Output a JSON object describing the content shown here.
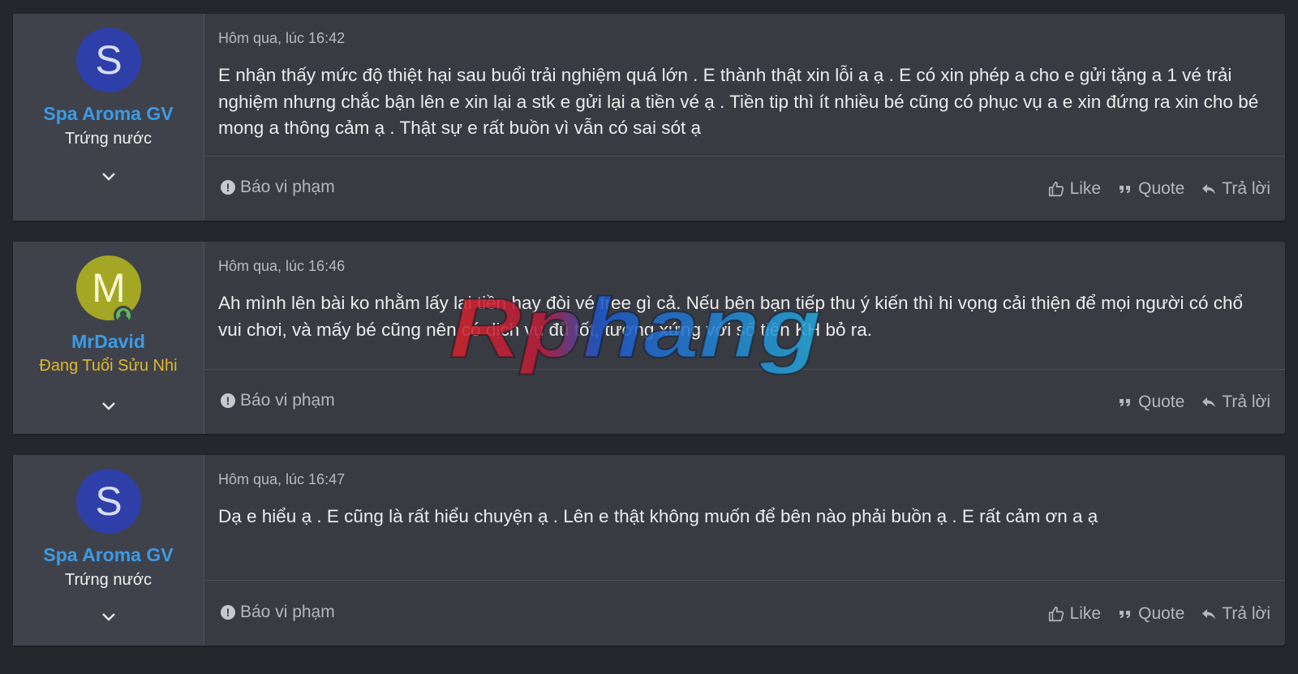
{
  "posts": [
    {
      "avatar_letter": "S",
      "avatar_color": "#2f3fa9",
      "username": "Spa Aroma GV",
      "user_title": "Trứng nước",
      "date": "Hôm qua, lúc 16:42",
      "content": "E nhận thấy mức độ thiệt hại sau buổi trải nghiệm quá lớn . E thành thật xin lỗi a ạ . E có xin phép a cho e gửi tặng a 1 vé trải nghiệm nhưng chắc bận lên e xin lại a stk e gửi lại a tiền vé ạ . Tiền tip thì ít nhiều bé cũng có phục vụ a e xin đứng ra xin cho bé mong a thông cảm ạ . Thật sự e rất buồn vì vẫn có sai sót ạ",
      "report_label": "Báo vi phạm",
      "like_label": "Like",
      "quote_label": "Quote",
      "reply_label": "Trả lời"
    },
    {
      "avatar_letter": "M",
      "avatar_color": "#a4a723",
      "username": "MrDavid",
      "user_title": "Đang Tuổi Sửu Nhi",
      "date": "Hôm qua, lúc 16:46",
      "content": "Ah mình lên bài ko nhằm lấy lại tiền hay đòi vé free gì cả. Nếu bên bạn tiếp thu ý kiến thì hi vọng cải thiện để mọi người có chổ vui chơi, và mấy bé cũng nên có dịch vụ đủ tốt, tương xứng với số tiền KH bỏ ra.",
      "report_label": "Báo vi phạm",
      "quote_label": "Quote",
      "reply_label": "Trả lời"
    },
    {
      "avatar_letter": "S",
      "avatar_color": "#2f3fa9",
      "username": "Spa Aroma GV",
      "user_title": "Trứng nước",
      "date": "Hôm qua, lúc 16:47",
      "content": "Dạ e hiểu ạ . E cũng là rất hiểu chuyện ạ . Lên e thật không muốn để bên nào phải buồn ạ . E rất cảm ơn a ạ",
      "report_label": "Báo vi phạm",
      "like_label": "Like",
      "quote_label": "Quote",
      "reply_label": "Trả lời"
    }
  ],
  "watermark": {
    "text": "Rphang"
  },
  "colors": {
    "username": "#3b9be6",
    "gold_title": "#e0b92c",
    "background": "#25272d",
    "post_bg": "#393b43"
  }
}
